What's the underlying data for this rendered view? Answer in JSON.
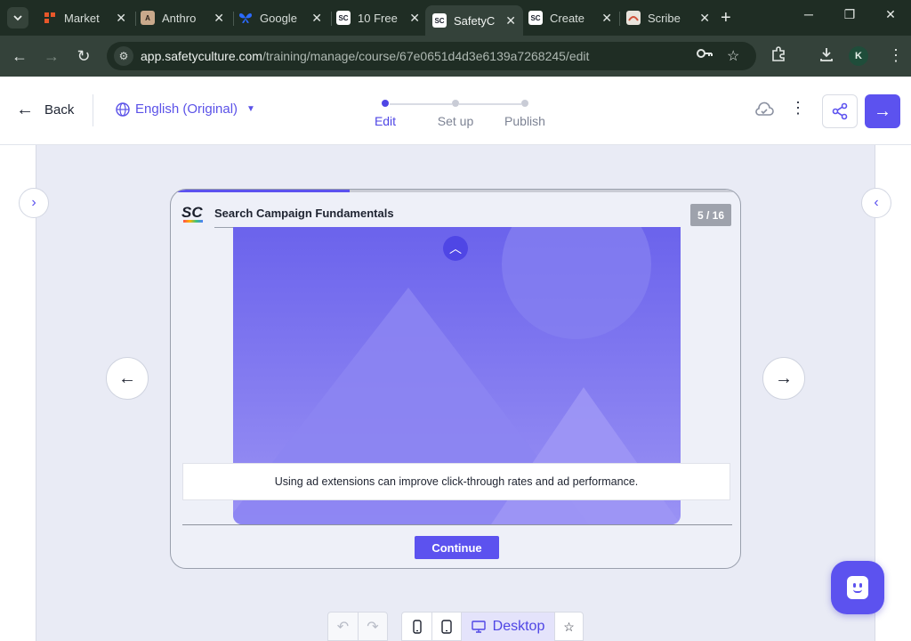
{
  "browser": {
    "tabs": [
      {
        "title": "Market",
        "favicon": "marketing-icon",
        "color": "#e8572a"
      },
      {
        "title": "Anthro",
        "favicon": "anthropic-icon",
        "color": "#c9a98b"
      },
      {
        "title": "Google",
        "favicon": "butterfly-icon",
        "color": "#2b6bff"
      },
      {
        "title": "10 Free",
        "favicon": "safetyculture-icon",
        "color": "#ffffff"
      },
      {
        "title": "SafetyC",
        "favicon": "safetyculture-icon",
        "color": "#ffffff",
        "active": true
      },
      {
        "title": "Create",
        "favicon": "safetyculture-icon",
        "color": "#ffffff"
      },
      {
        "title": "Scribe",
        "favicon": "scribe-icon",
        "color": "#e9e4dc"
      }
    ],
    "url_host": "app.safetyculture.com",
    "url_path": "/training/manage/course/67e0651d4d3e6139a7268245/edit",
    "profile_initial": "K"
  },
  "header": {
    "back_label": "Back",
    "language": "English (Original)",
    "steps": [
      {
        "label": "Edit",
        "active": true
      },
      {
        "label": "Set up",
        "active": false
      },
      {
        "label": "Publish",
        "active": false
      }
    ]
  },
  "slide": {
    "course_title": "Search Campaign Fundamentals",
    "counter": "5 / 16",
    "progress": 0.3125,
    "logo_text": "SC",
    "caption": "Using ad extensions can improve click-through rates and ad performance.",
    "continue_label": "Continue"
  },
  "toolbar": {
    "device_desktop_label": "Desktop"
  },
  "colors": {
    "accent": "#5c52ef",
    "browser_bg": "#1f2d24"
  }
}
